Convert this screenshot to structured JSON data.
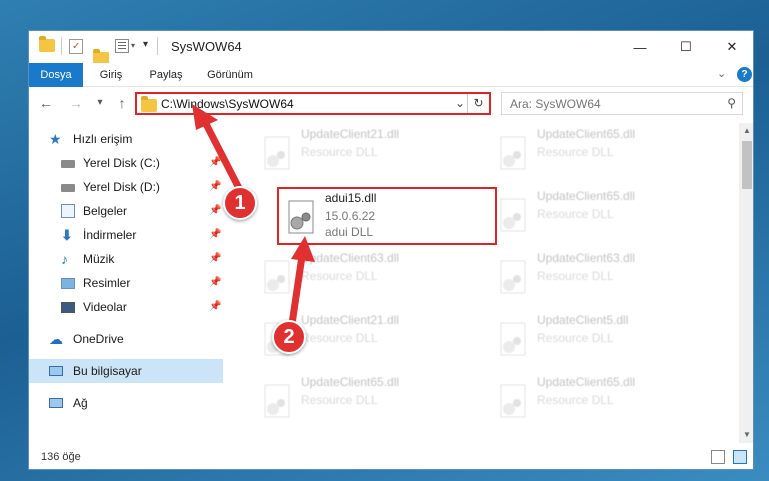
{
  "window": {
    "title": "SysWOW64",
    "controls": {
      "minimize": "—",
      "maximize": "☐",
      "close": "✕"
    }
  },
  "ribbon": {
    "tabs": [
      {
        "label": "Dosya",
        "active": true
      },
      {
        "label": "Giriş"
      },
      {
        "label": "Paylaş"
      },
      {
        "label": "Görünüm"
      }
    ],
    "expand_icon": "chevron-down-icon",
    "help_icon": "help-icon"
  },
  "nav": {
    "back": "←",
    "forward": "→",
    "recent": "▾",
    "up": "↑",
    "address": "C:\\Windows\\SysWOW64",
    "search_placeholder": "Ara: SysWOW64"
  },
  "sidebar": {
    "items": [
      {
        "label": "Hızlı erişim",
        "icon": "star-icon"
      },
      {
        "label": "Yerel Disk (C:)",
        "icon": "drive-icon",
        "pinned": true
      },
      {
        "label": "Yerel Disk (D:)",
        "icon": "drive-icon",
        "pinned": true
      },
      {
        "label": "Belgeler",
        "icon": "documents-icon",
        "pinned": true
      },
      {
        "label": "İndirmeler",
        "icon": "download-icon",
        "pinned": true
      },
      {
        "label": "Müzik",
        "icon": "music-icon",
        "pinned": true
      },
      {
        "label": "Resimler",
        "icon": "pictures-icon",
        "pinned": true
      },
      {
        "label": "Videolar",
        "icon": "videos-icon",
        "pinned": true
      },
      {
        "label": "OneDrive",
        "icon": "cloud-icon"
      },
      {
        "label": "Bu bilgisayar",
        "icon": "computer-icon",
        "selected": true
      },
      {
        "label": "Ağ",
        "icon": "network-icon"
      }
    ]
  },
  "files": [
    {
      "name": "UpdateClient21.dll",
      "line1": "Resource DLL",
      "line2": ""
    },
    {
      "name": "UpdateClient65.dll",
      "line1": "Resource DLL",
      "line2": ""
    },
    {
      "name": "adui15.dll",
      "line1": "15.0.6.22",
      "line2": "adui DLL"
    },
    {
      "name": "UpdateClient65.dll",
      "line1": "Resource DLL",
      "line2": ""
    },
    {
      "name": "UpdateClient63.dll",
      "line1": "Resource DLL",
      "line2": ""
    },
    {
      "name": "UpdateClient63.dll",
      "line1": "Resource DLL",
      "line2": ""
    },
    {
      "name": "UpdateClient21.dll",
      "line1": "Resource DLL",
      "line2": ""
    },
    {
      "name": "UpdateClient5.dll",
      "line1": "Resource DLL",
      "line2": ""
    },
    {
      "name": "UpdateClient65.dll",
      "line1": "Resource DLL",
      "line2": ""
    },
    {
      "name": "UpdateClient65.dll",
      "line1": "Resource DLL",
      "line2": ""
    }
  ],
  "status": {
    "count": "136 öğe"
  },
  "annotations": {
    "step1": "1",
    "step2": "2"
  },
  "colors": {
    "accent": "#1979ca",
    "highlight": "#e02424",
    "selection": "#cce4f7"
  }
}
